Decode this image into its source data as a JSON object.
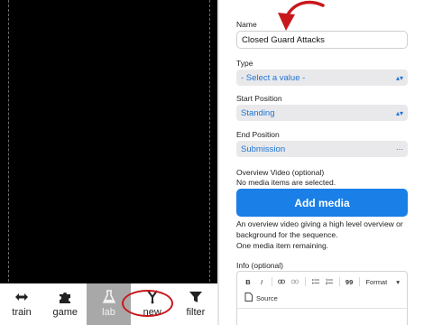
{
  "bottom_nav": {
    "items": [
      {
        "label": "train",
        "icon": "arrows-icon"
      },
      {
        "label": "game",
        "icon": "puzzle-icon"
      },
      {
        "label": "lab",
        "icon": "flask-icon",
        "active": true
      },
      {
        "label": "new",
        "icon": "fork-icon"
      },
      {
        "label": "filter",
        "icon": "filter-icon"
      }
    ]
  },
  "form": {
    "name_label": "Name",
    "name_value": "Closed Guard Attacks",
    "type_label": "Type",
    "type_value": "- Select a value -",
    "start_label": "Start Position",
    "start_value": "Standing",
    "end_label": "End Position",
    "end_value": "Submission",
    "overview_label": "Overview Video (optional)",
    "no_media": "No media items are selected.",
    "add_media": "Add media",
    "overview_help_1": "An overview video giving a high level overview or",
    "overview_help_2": "background for the sequence.",
    "remaining": "One media item remaining.",
    "info_label": "Info (optional)",
    "toolbar": {
      "bold": "B",
      "italic": "I",
      "blockquote": "99",
      "format": "Format",
      "source": "Source"
    }
  },
  "colors": {
    "accent": "#1a7fe6",
    "select_text": "#1f74d6",
    "annotation": "#c8181c",
    "active_tab": "#a8a8a8"
  }
}
